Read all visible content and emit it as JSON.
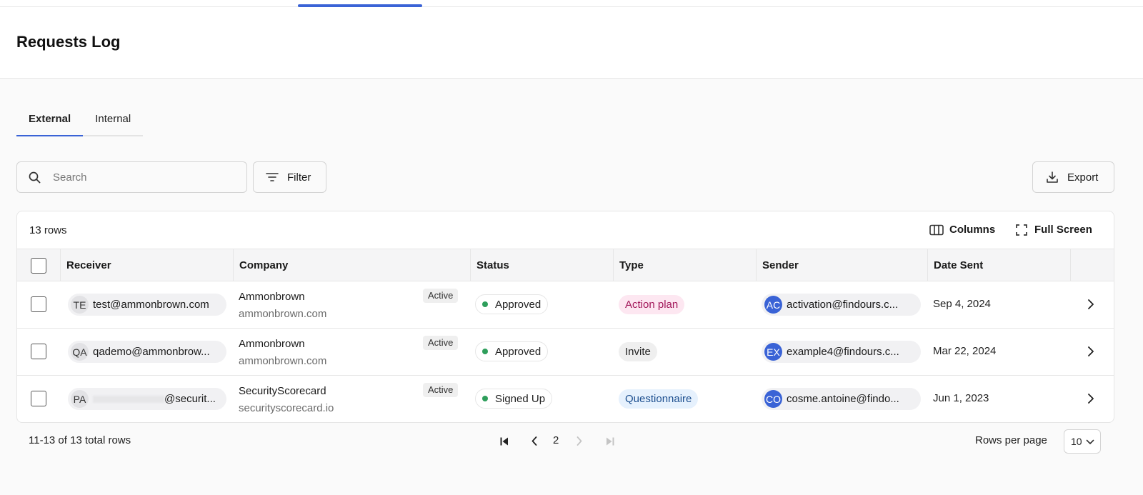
{
  "page": {
    "title": "Requests Log"
  },
  "tabs": [
    {
      "label": "External",
      "active": true
    },
    {
      "label": "Internal",
      "active": false
    }
  ],
  "search": {
    "placeholder": "Search",
    "value": ""
  },
  "toolbar": {
    "filter_label": "Filter",
    "export_label": "Export"
  },
  "table": {
    "row_count": "13 rows",
    "columns_label": "Columns",
    "fullscreen_label": "Full Screen",
    "headers": [
      "Receiver",
      "Company",
      "Status",
      "Type",
      "Sender",
      "Date Sent"
    ],
    "rows": [
      {
        "receiver_initials": "TE",
        "receiver": "test@ammonbrown.com",
        "company_name": "Ammonbrown",
        "company_domain": "ammonbrown.com",
        "company_badge": "Active",
        "status": "Approved",
        "type": "Action plan",
        "sender_initials": "AC",
        "sender": "activation@findours.c...",
        "date_sent": "Sep 4, 2024"
      },
      {
        "receiver_initials": "QA",
        "receiver": "qademo@ammonbrow...",
        "company_name": "Ammonbrown",
        "company_domain": "ammonbrown.com",
        "company_badge": "Active",
        "status": "Approved",
        "type": "Invite",
        "sender_initials": "EX",
        "sender": "example4@findours.c...",
        "date_sent": "Mar 22, 2024"
      },
      {
        "receiver_initials": "PA",
        "receiver": "@securit...",
        "company_name": "SecurityScorecard",
        "company_domain": "securityscorecard.io",
        "company_badge": "Active",
        "status": "Signed Up",
        "type": "Questionnaire",
        "sender_initials": "CO",
        "sender": "cosme.antoine@findo...",
        "date_sent": "Jun 1, 2023"
      }
    ]
  },
  "pagination": {
    "range": "11-13 of 13 total rows",
    "current_page": "2",
    "rows_per_page_label": "Rows per page",
    "rows_per_page": "10"
  },
  "colors": {
    "accent": "#3a63d6",
    "status_dot": "#2e9e5b",
    "action_plan_bg": "#fde7f1",
    "action_plan_fg": "#a3195b",
    "invite_bg": "#efefef",
    "invite_fg": "#222222",
    "questionnaire_bg": "#e6f1fd",
    "questionnaire_fg": "#1d4f8f"
  },
  "icons": {
    "search": "search-icon",
    "filter": "filter-icon",
    "export": "download-icon",
    "columns": "columns-icon",
    "fullscreen": "fullscreen-icon",
    "row_action": "chevron-right-icon",
    "first_page": "first-page-icon",
    "prev_page": "chevron-left-icon",
    "next_page": "chevron-right-icon",
    "last_page": "last-page-icon",
    "select": "chevron-down-icon"
  }
}
